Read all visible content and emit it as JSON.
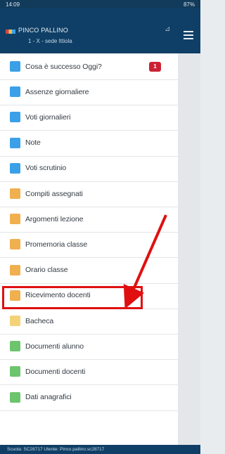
{
  "statusbar": {
    "time": "14:09",
    "right": "87%"
  },
  "header": {
    "name": "PINCO PALLINO",
    "class": "1 - X - sede Ittiola"
  },
  "menu": [
    {
      "label": "Cosa è successo Oggi?",
      "color": "#3aa0e8",
      "badge": "1"
    },
    {
      "label": "Assenze giornaliere",
      "color": "#3aa0e8"
    },
    {
      "label": "Voti giornalieri",
      "color": "#3aa0e8"
    },
    {
      "label": "Note",
      "color": "#3aa0e8"
    },
    {
      "label": "Voti scrutinio",
      "color": "#3aa0e8"
    },
    {
      "label": "Compiti assegnati",
      "color": "#f0b04f"
    },
    {
      "label": "Argomenti lezione",
      "color": "#f0b04f"
    },
    {
      "label": "Promemoria classe",
      "color": "#f0b04f"
    },
    {
      "label": "Orario classe",
      "color": "#f0b04f"
    },
    {
      "label": "Ricevimento docenti",
      "color": "#f0b04f"
    },
    {
      "label": "Bacheca",
      "color": "#f3d27a"
    },
    {
      "label": "Documenti alunno",
      "color": "#6cc46c"
    },
    {
      "label": "Documenti docenti",
      "color": "#6cc46c"
    },
    {
      "label": "Dati anagrafici",
      "color": "#6cc46c"
    }
  ],
  "footer": "Scuola: SC28717 Utente: Pinco.pallino.sc28717",
  "annotation": {
    "color": "#e01010"
  }
}
